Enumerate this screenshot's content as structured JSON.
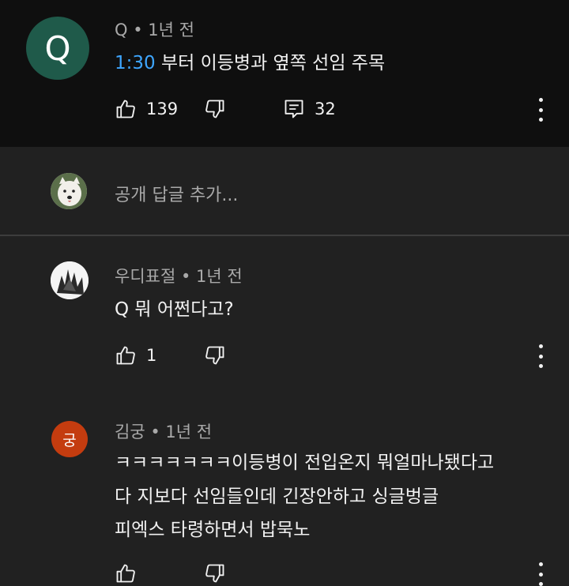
{
  "main_comment": {
    "avatar_letter": "Q",
    "author": "Q",
    "time": "1년 전",
    "timestamp_link": "1:30",
    "text": " 부터 이등병과 옆쪽 선임 주목",
    "likes": "139",
    "replies": "32"
  },
  "reply_box": {
    "placeholder": "공개 답글 추가..."
  },
  "replies": [
    {
      "author": "우디표절",
      "time": "1년 전",
      "text": "Q 뭐 어쩐다고?",
      "likes": "1"
    },
    {
      "avatar_letter": "궁",
      "author": "김궁",
      "time": "1년 전",
      "lines": [
        "ㅋㅋㅋㅋㅋㅋㅋ이등병이 전입온지 뭐얼마나됐다고",
        "다 지보다 선임들인데 긴장안하고 싱글벙글",
        "피엑스 타령하면서 밥묵노"
      ]
    }
  ],
  "separator": "•",
  "colors": {
    "top_bg": "#0f0f0f",
    "body_bg": "#212121",
    "link": "#3ea6ff",
    "avatar_q": "#1f5a4a",
    "avatar_g": "#c43c0f"
  }
}
